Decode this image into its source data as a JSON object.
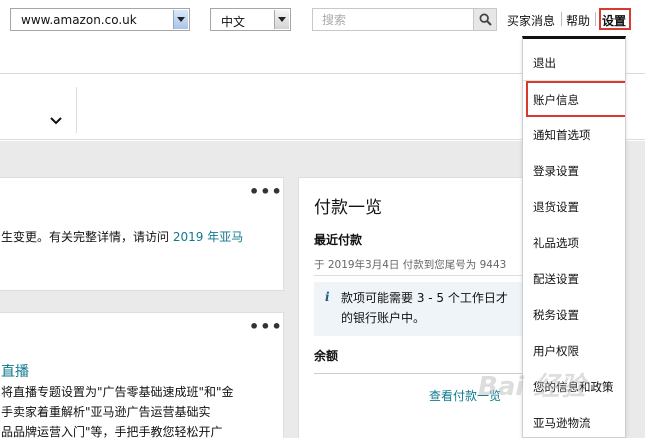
{
  "header": {
    "marketplace_select": "www.amazon.co.uk",
    "language_select": "中文",
    "search_placeholder": "搜索",
    "links": {
      "messages": "买家消息",
      "help": "帮助",
      "settings": "设置"
    }
  },
  "cards": {
    "notice": {
      "text": "生变更。有关完整详情，请访问",
      "link": "2019 年亚马"
    },
    "news": {
      "heading": "直播",
      "lines": [
        "将直播专题设置为\"广告零基础速成班\"和\"金",
        "手卖家着重解析\"亚马逊广告运营基础实",
        "品品牌运营入门\"等，手把手教您轻松开广"
      ]
    },
    "payments": {
      "title": "付款一览",
      "recent_label": "最近付款",
      "recent_detail": "于 2019年3月4日 付款到您尾号为 9443",
      "info_icon": "i",
      "info_line1": "款项可能需要 3 - 5 个工作日才",
      "info_line2": "的银行账户中。",
      "balance_label": "余额",
      "view_all": "查看付款一览"
    }
  },
  "settings_menu": {
    "items": [
      "退出",
      "账户信息",
      "通知首选项",
      "登录设置",
      "退货设置",
      "礼品选项",
      "配送设置",
      "税务设置",
      "用户权限",
      "您的信息和政策",
      "亚马逊物流"
    ],
    "highlighted_index": 1
  },
  "watermark": "Bai 经验",
  "colors": {
    "link": "#0f7a8e",
    "highlight_border": "#d9392e",
    "content_bg": "#eaeaea",
    "info_bg": "#eef4f8"
  }
}
